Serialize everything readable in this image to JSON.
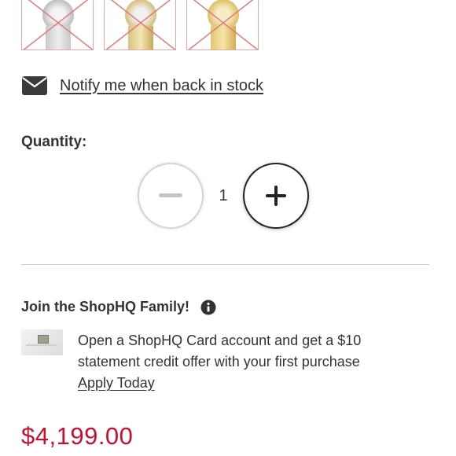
{
  "colors": {
    "price_red": "#c8102e",
    "unavailable_cross": "#e07a7a",
    "text": "#333333"
  },
  "swatches": [
    {
      "name": "silver",
      "available": false
    },
    {
      "name": "two-tone gold",
      "available": false
    },
    {
      "name": "gold",
      "available": false
    }
  ],
  "notify": {
    "icon": "envelope-icon",
    "link_text": "Notify me when back in stock"
  },
  "quantity": {
    "label": "Quantity:",
    "value": "1",
    "decrement_icon": "minus-icon",
    "increment_icon": "plus-icon"
  },
  "family": {
    "title": "Join the ShopHQ Family!",
    "info_icon": "info-icon",
    "card_image": "shophq-card-thumbnail",
    "offer_line1": "Open a ShopHQ Card account and get a $10",
    "offer_line2": "statement credit offer with your first purchase",
    "apply_link": "Apply Today"
  },
  "price": "$4,199.00"
}
